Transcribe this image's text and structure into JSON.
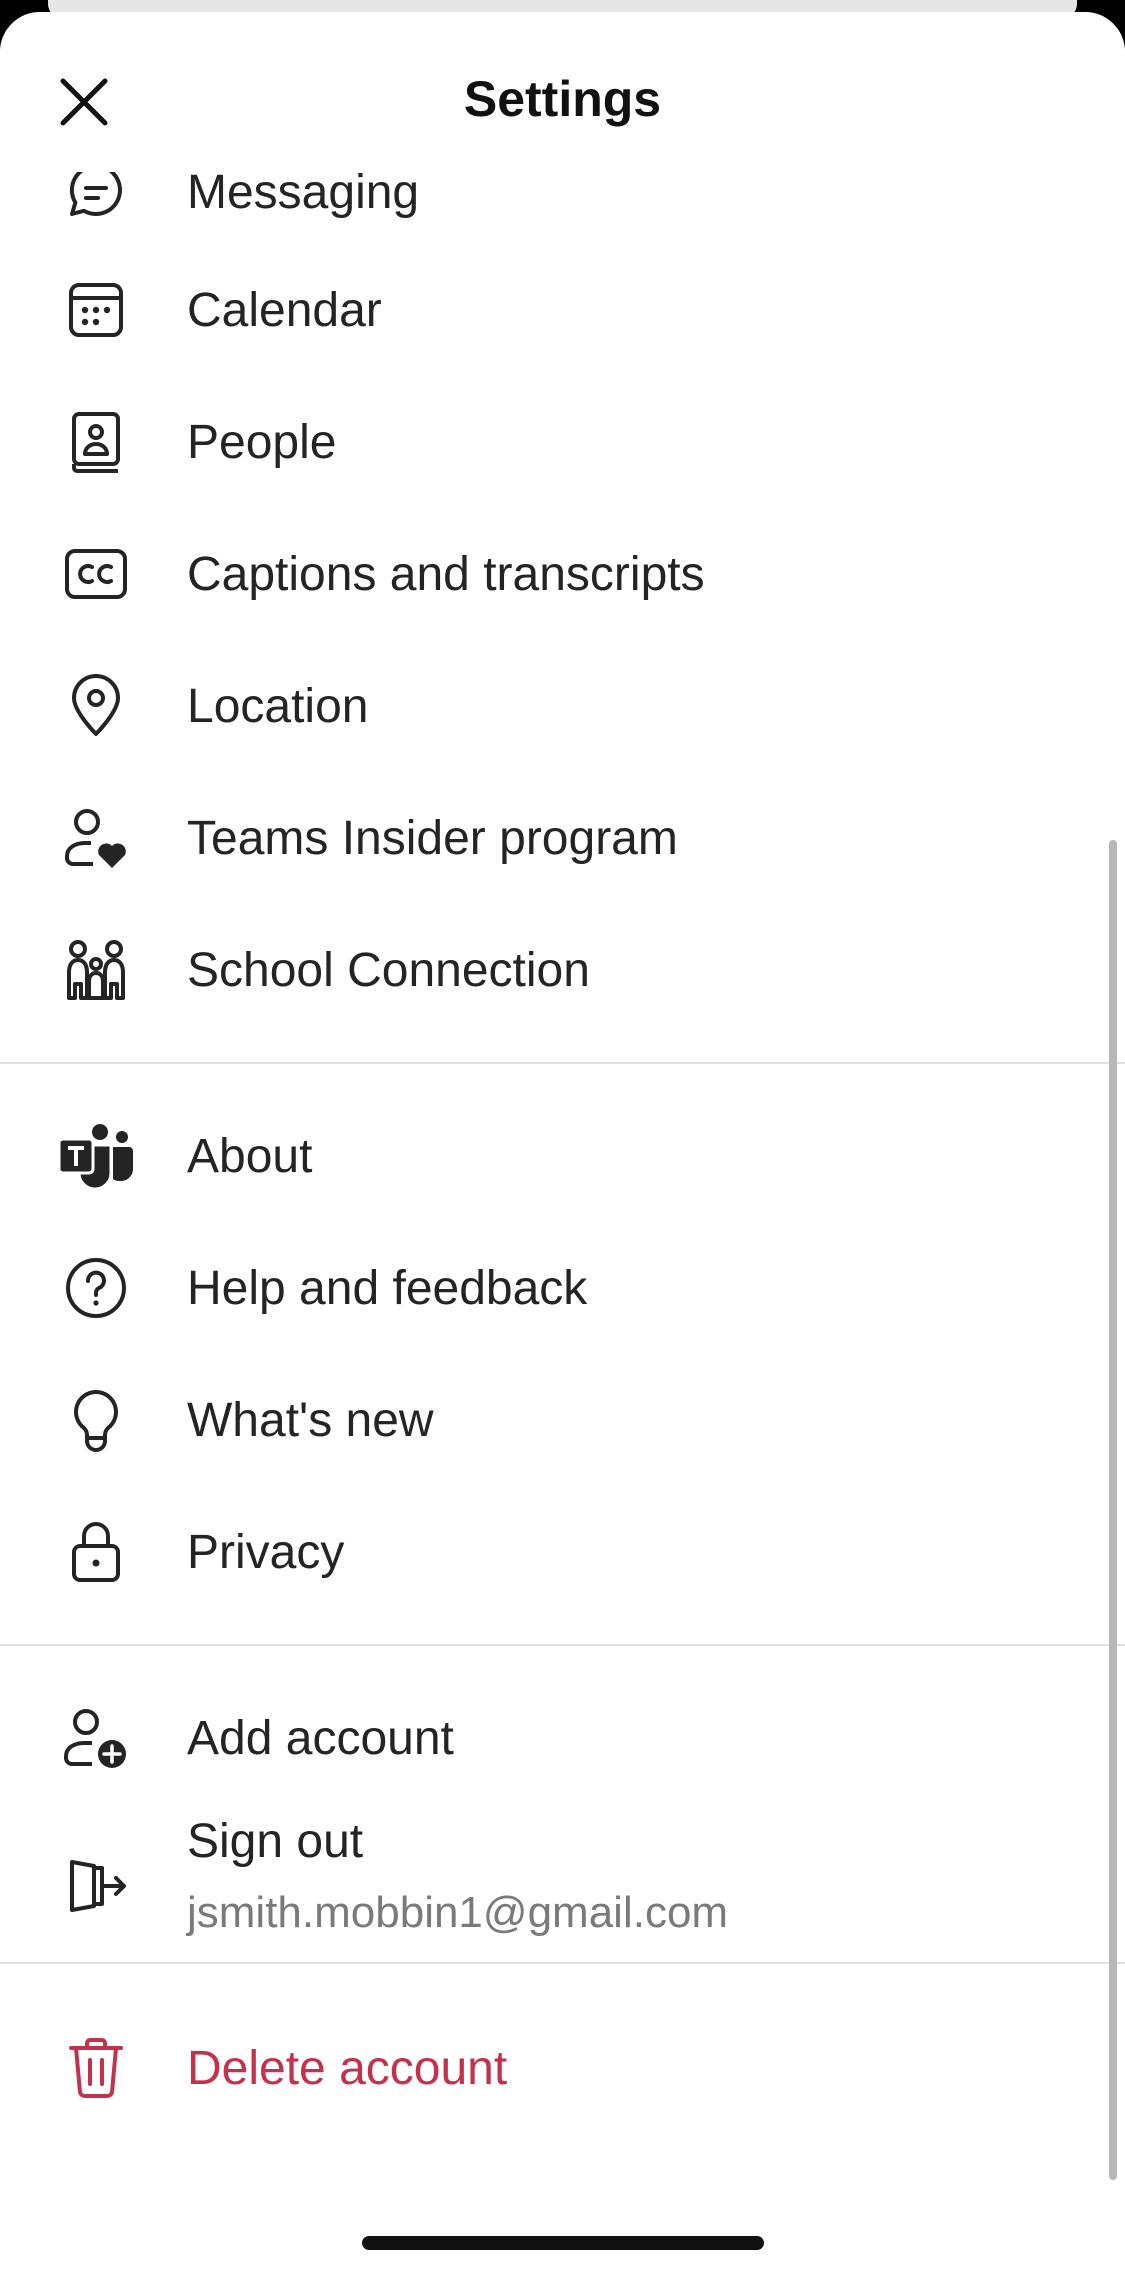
{
  "header": {
    "title": "Settings",
    "close_icon": "close-icon"
  },
  "colors": {
    "danger": "#c4314b",
    "text": "#242424",
    "secondary": "#7a7a7a",
    "divider": "#e1e1e1"
  },
  "items": {
    "messaging": {
      "label": "Messaging",
      "icon": "chat-icon"
    },
    "calendar": {
      "label": "Calendar",
      "icon": "calendar-icon"
    },
    "people": {
      "label": "People",
      "icon": "contact-book-icon"
    },
    "captions": {
      "label": "Captions and transcripts",
      "icon": "closed-captions-icon"
    },
    "location": {
      "label": "Location",
      "icon": "location-pin-icon"
    },
    "insider": {
      "label": "Teams Insider program",
      "icon": "person-heart-icon"
    },
    "school": {
      "label": "School Connection",
      "icon": "family-icon"
    },
    "about": {
      "label": "About",
      "icon": "teams-logo-icon"
    },
    "help": {
      "label": "Help and feedback",
      "icon": "help-circle-icon"
    },
    "whatsnew": {
      "label": "What's new",
      "icon": "lightbulb-icon"
    },
    "privacy": {
      "label": "Privacy",
      "icon": "lock-icon"
    },
    "add_account": {
      "label": "Add account",
      "icon": "person-add-icon"
    },
    "sign_out": {
      "label": "Sign out",
      "email": "jsmith.mobbin1@gmail.com",
      "icon": "sign-out-icon"
    },
    "delete_account": {
      "label": "Delete account",
      "icon": "trash-icon"
    }
  }
}
